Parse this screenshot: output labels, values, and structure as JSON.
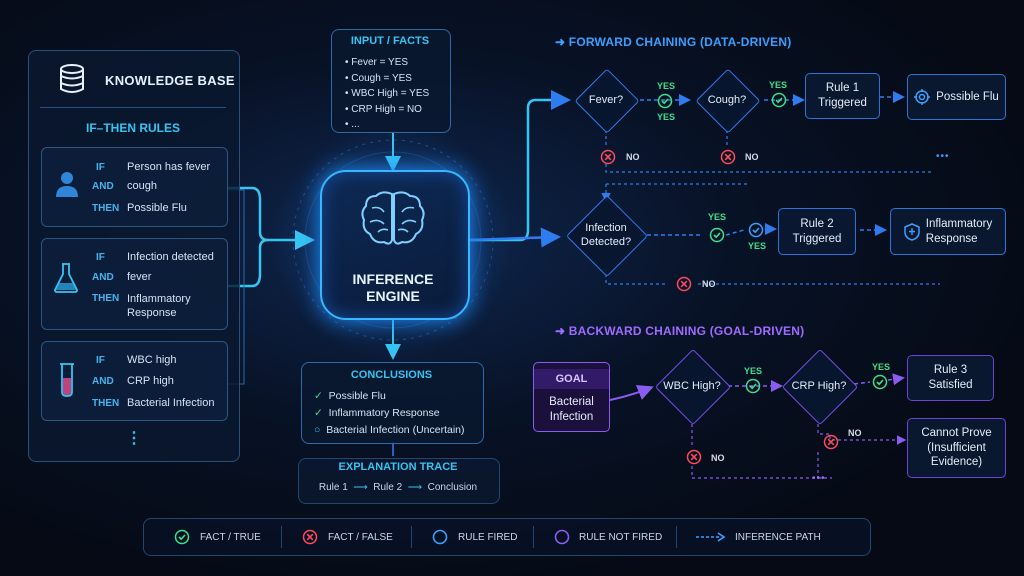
{
  "knowledge_base": {
    "title": "KNOWLEDGE BASE",
    "subtitle": "IF–THEN RULES",
    "rules": [
      {
        "if": "IF",
        "and": "AND",
        "then": "THEN",
        "cond1": "Person has fever",
        "cond2": "cough",
        "result": "Possible Flu",
        "icon": "person-icon"
      },
      {
        "if": "IF",
        "and": "AND",
        "then": "THEN",
        "cond1": "Infection detected",
        "cond2": "fever",
        "result": "Inflammatory Response",
        "icon": "flask-icon"
      },
      {
        "if": "IF",
        "and": "AND",
        "then": "THEN",
        "cond1": "WBC high",
        "cond2": "CRP high",
        "result": "Bacterial Infection",
        "icon": "test-tube-icon"
      }
    ],
    "more": "⋮"
  },
  "input_facts": {
    "title": "INPUT / FACTS",
    "items": [
      "Fever = YES",
      "Cough = YES",
      "WBC High = YES",
      "CRP High = NO",
      "..."
    ]
  },
  "engine": {
    "line1": "INFERENCE",
    "line2": "ENGINE"
  },
  "conclusions": {
    "title": "CONCLUSIONS",
    "items": [
      {
        "mark": "✓",
        "text": "Possible Flu"
      },
      {
        "mark": "✓",
        "text": "Inflammatory Response"
      },
      {
        "mark": "○",
        "text": "Bacterial Infection (Uncertain)"
      }
    ]
  },
  "explanation": {
    "title": "EXPLANATION TRACE",
    "steps": [
      "Rule 1",
      "Rule 2",
      "Conclusion"
    ]
  },
  "forward": {
    "title": "FORWARD CHAINING (DATA-DRIVEN)",
    "fever": "Fever?",
    "cough": "Cough?",
    "infection_1": "Infection",
    "infection_2": "Detected?",
    "rule1_1": "Rule 1",
    "rule1_2": "Triggered",
    "rule2_1": "Rule 2",
    "rule2_2": "Triggered",
    "possible_flu": "Possible Flu",
    "inflam_1": "Inflammatory",
    "inflam_2": "Response",
    "yes": "YES",
    "no": "NO",
    "ellipsis": "•••"
  },
  "backward": {
    "title": "BACKWARD CHAINING (GOAL-DRIVEN)",
    "goal": "GOAL",
    "goal_1": "Bacterial",
    "goal_2": "Infection",
    "wbc": "WBC High?",
    "crp": "CRP High?",
    "rule3_1": "Rule 3",
    "rule3_2": "Satisfied",
    "cannot_1": "Cannot Prove",
    "cannot_2": "(Insufficient",
    "cannot_3": "Evidence)",
    "yes": "YES",
    "no": "NO",
    "ellipsis": "•••"
  },
  "legend": {
    "fact_true": "FACT / TRUE",
    "fact_false": "FACT / FALSE",
    "rule_fired": "RULE FIRED",
    "rule_not_fired": "RULE NOT FIRED",
    "inference_path": "INFERENCE PATH"
  },
  "colors": {
    "cyan": "#36c4f2",
    "blue": "#2e7df0",
    "purple": "#8a5cf0",
    "green": "#3ee08a",
    "red": "#ff4a5a"
  }
}
